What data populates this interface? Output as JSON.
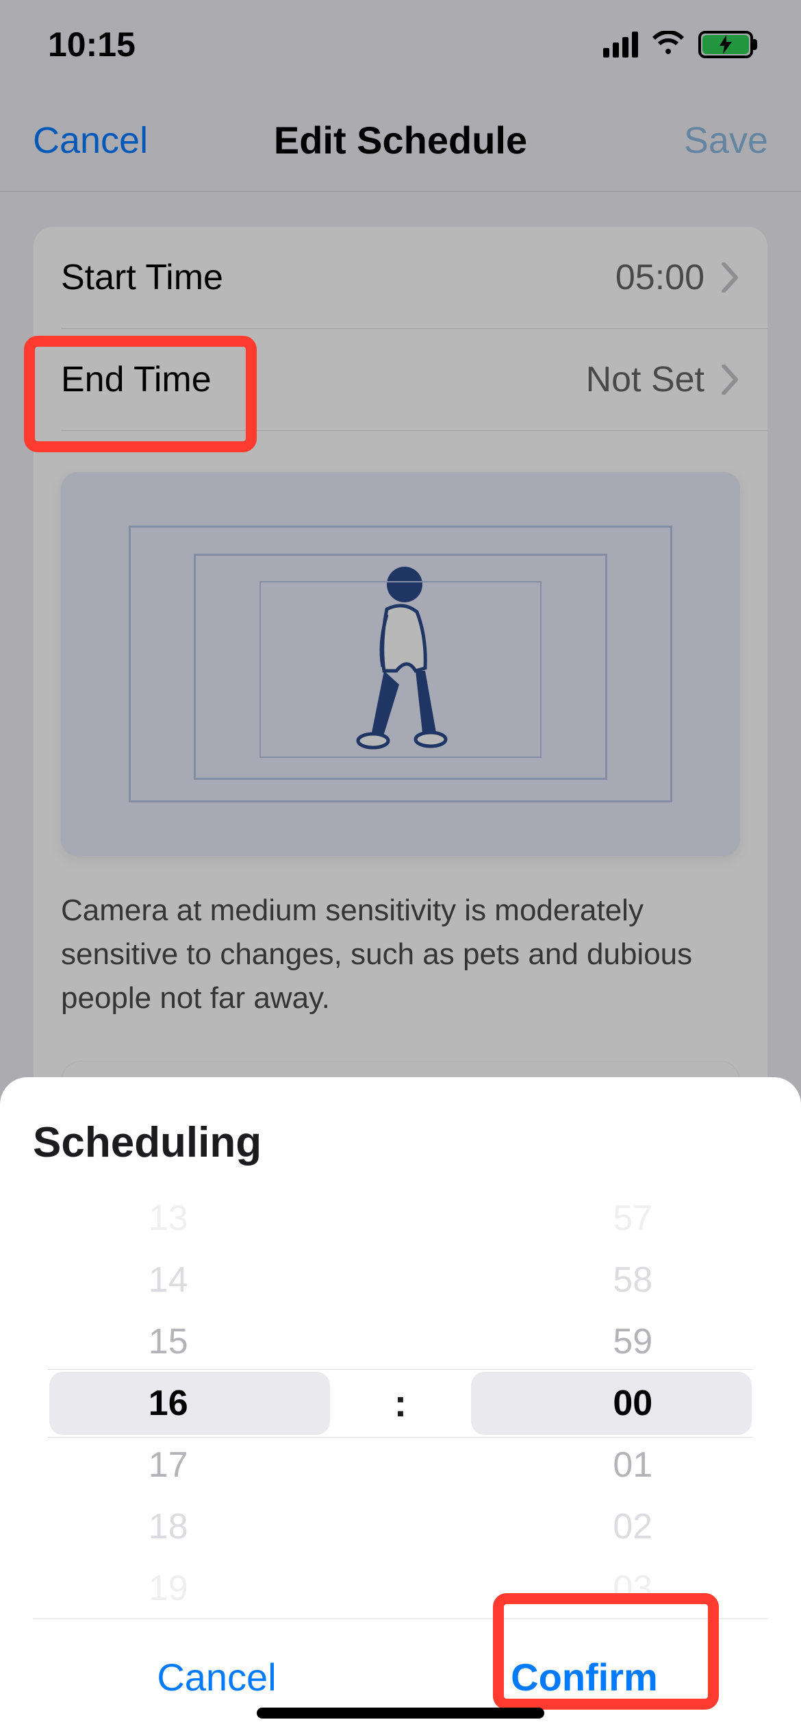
{
  "status": {
    "time": "10:15"
  },
  "nav": {
    "cancel": "Cancel",
    "title": "Edit Schedule",
    "save": "Save"
  },
  "schedule": {
    "start_label": "Start Time",
    "start_value": "05:00",
    "end_label": "End Time",
    "end_value": "Not Set"
  },
  "description": "Camera at medium sensitivity is moderately sensitive to changes, such as pets and dubious people not far away.",
  "sheet": {
    "title": "Scheduling",
    "separator": ":",
    "hours": {
      "minus3": "13",
      "minus2": "14",
      "minus1": "15",
      "selected": "16",
      "plus1": "17",
      "plus2": "18",
      "plus3": "19"
    },
    "minutes": {
      "minus3": "57",
      "minus2": "58",
      "minus1": "59",
      "selected": "00",
      "plus1": "01",
      "plus2": "02",
      "plus3": "03"
    },
    "cancel": "Cancel",
    "confirm": "Confirm"
  }
}
